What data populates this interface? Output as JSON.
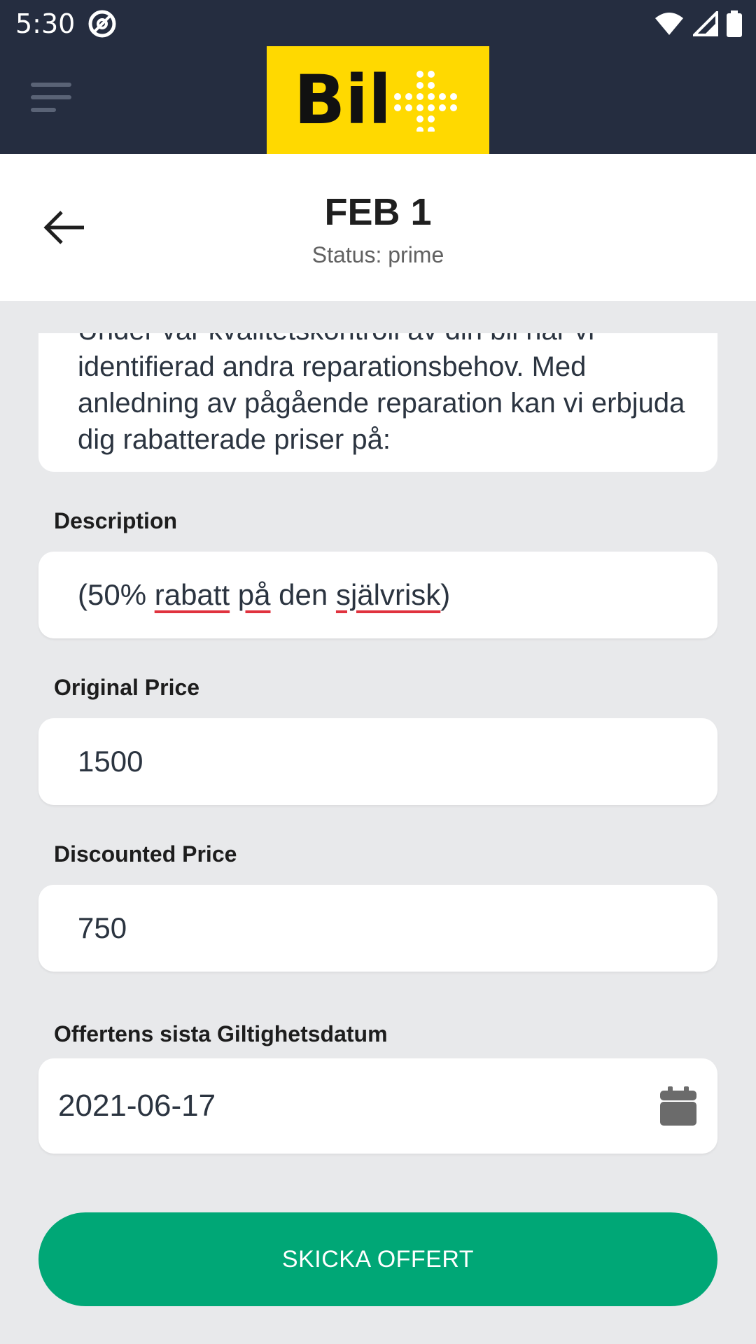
{
  "status_bar": {
    "time": "5:30",
    "icons": [
      "at-sign-icon",
      "wifi-icon",
      "signal-icon",
      "battery-icon"
    ]
  },
  "app_bar": {
    "logo_text": "Bil",
    "logo_color": "#ffd900",
    "bar_color": "#252d40"
  },
  "header": {
    "title": "FEB 1",
    "subtitle": "Status: prime"
  },
  "intro": {
    "text": "Under vår kvalitetskontroll av din bil har vi identifierad andra reparationsbehov. Med anledning av pågående reparation kan vi erbjuda dig rabatterade priser på:"
  },
  "fields": {
    "description": {
      "label": "Description",
      "value_parts": [
        "(50% ",
        "rabatt",
        " ",
        "på",
        " den ",
        "självrisk",
        ")"
      ]
    },
    "original_price": {
      "label": "Original Price",
      "value": "1500"
    },
    "discounted_price": {
      "label": "Discounted Price",
      "value": "750"
    },
    "valid_date": {
      "label": "Offertens sista Giltighetsdatum",
      "value": "2021-06-17"
    }
  },
  "submit": {
    "label": "SKICKA OFFERT",
    "color": "#00a776"
  }
}
